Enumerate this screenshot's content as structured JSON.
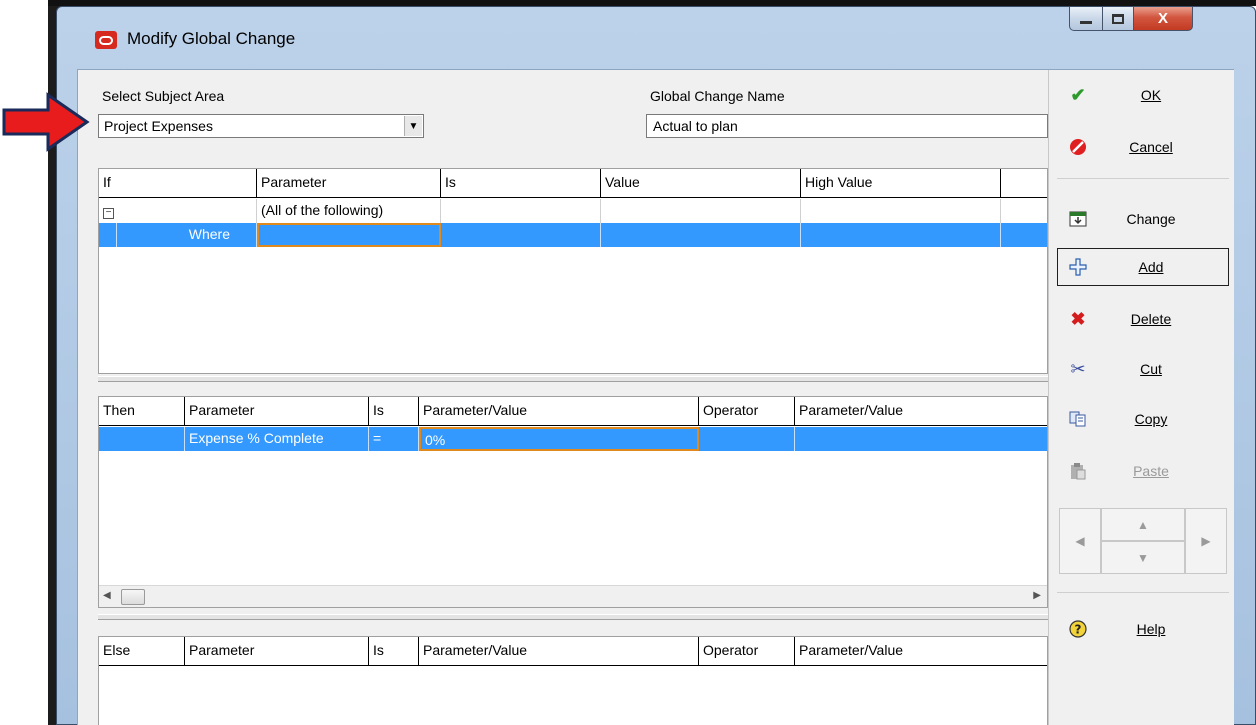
{
  "window": {
    "title": "Modify Global Change",
    "caption_buttons": {
      "minimize": "—",
      "maximize": "□",
      "close": "X"
    }
  },
  "subject_area": {
    "label": "Select Subject Area",
    "value": "Project Expenses"
  },
  "global_change_name": {
    "label": "Global Change Name",
    "value": "Actual to plan"
  },
  "if_grid": {
    "columns": [
      "If",
      "Parameter",
      "Is",
      "Value",
      "High Value"
    ],
    "rows": [
      {
        "if": "−",
        "parameter": "(All of the following)",
        "is": "",
        "value": "",
        "high_value": ""
      },
      {
        "if": "Where",
        "parameter": "",
        "is": "",
        "value": "",
        "high_value": ""
      }
    ]
  },
  "then_grid": {
    "columns": [
      "Then",
      "Parameter",
      "Is",
      "Parameter/Value",
      "Operator",
      "Parameter/Value"
    ],
    "rows": [
      {
        "then": "",
        "parameter": "Expense % Complete",
        "is": "=",
        "param_value": "0%",
        "operator": "",
        "param_value2": ""
      }
    ]
  },
  "else_grid": {
    "columns": [
      "Else",
      "Parameter",
      "Is",
      "Parameter/Value",
      "Operator",
      "Parameter/Value"
    ]
  },
  "buttons": {
    "ok": "OK",
    "cancel": "Cancel",
    "change": "Change",
    "add": "Add",
    "delete": "Delete",
    "cut": "Cut",
    "copy": "Copy",
    "paste": "Paste",
    "help": "Help"
  },
  "colors": {
    "selection": "#3399ff",
    "focus_border": "#e08a1e",
    "arrow": "#e81c1c"
  }
}
